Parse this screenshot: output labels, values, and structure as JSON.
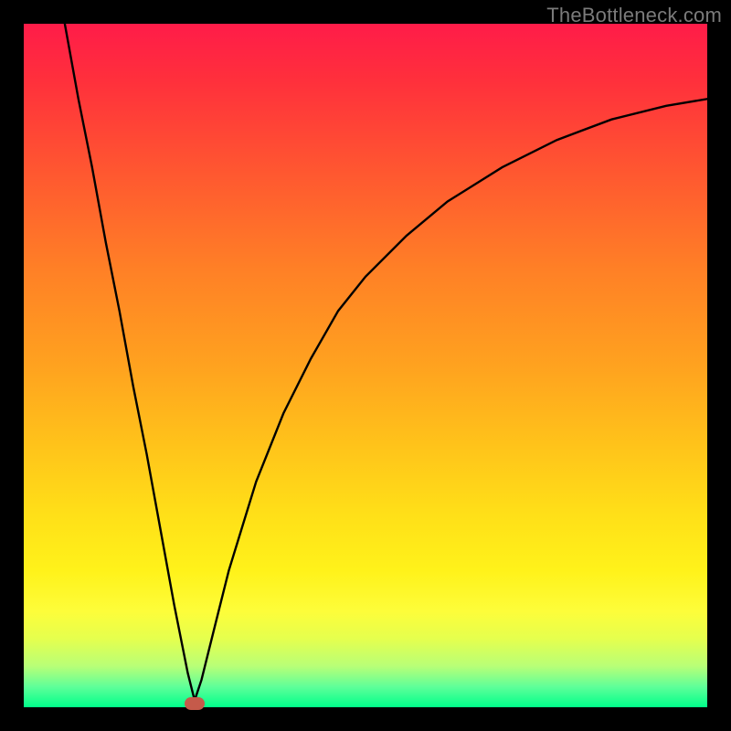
{
  "watermark": "TheBottleneck.com",
  "chart_data": {
    "type": "line",
    "title": "",
    "xlabel": "",
    "ylabel": "",
    "xlim": [
      0,
      100
    ],
    "ylim": [
      0,
      100
    ],
    "grid": false,
    "legend": false,
    "background_gradient": {
      "top_color": "#ff1c49",
      "bottom_color": "#00ff8a",
      "description": "vertical red-to-green gradient (bottleneck heat scale)"
    },
    "series": [
      {
        "name": "bottleneck-curve",
        "description": "V-shaped curve: steep linear descent on left, minimum near x≈25, asymptotic rise to right",
        "color": "#000000",
        "x": [
          6,
          8,
          10,
          12,
          14,
          16,
          18,
          20,
          22,
          24,
          25,
          26,
          28,
          30,
          34,
          38,
          42,
          46,
          50,
          56,
          62,
          70,
          78,
          86,
          94,
          100
        ],
        "y": [
          100,
          89,
          79,
          68,
          58,
          47,
          37,
          26,
          15,
          5,
          1,
          4,
          12,
          20,
          33,
          43,
          51,
          58,
          63,
          69,
          74,
          79,
          83,
          86,
          88,
          89
        ]
      }
    ],
    "marker": {
      "name": "optimum-point",
      "color": "#c55a4a",
      "x": 25,
      "y": 0.5
    }
  }
}
